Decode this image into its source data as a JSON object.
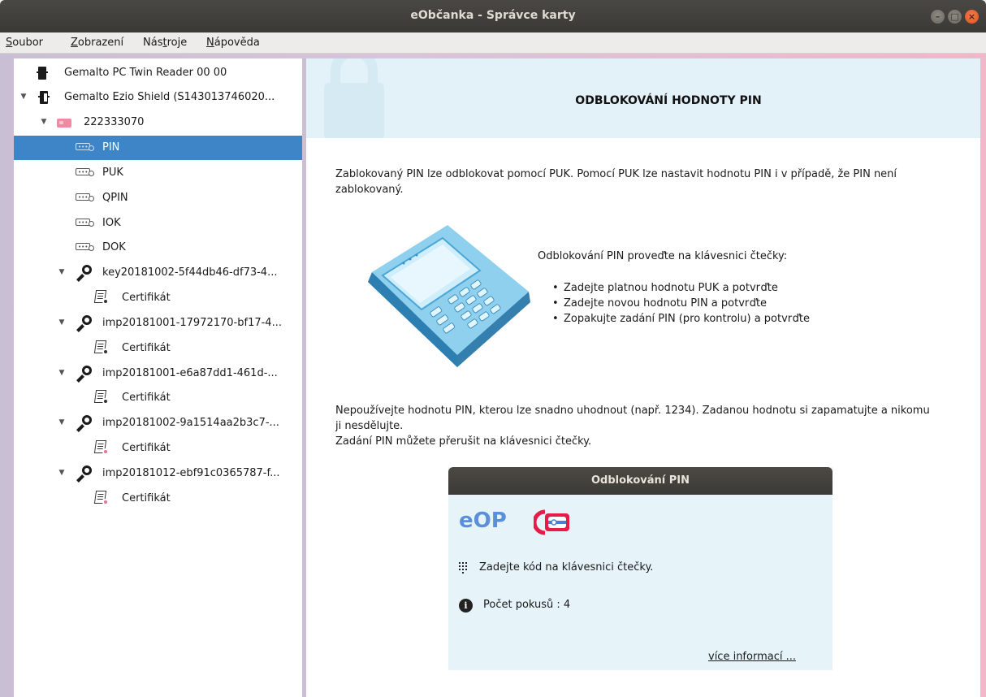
{
  "window": {
    "title": "eObčanka - Správce karty",
    "minimize_icon": "minimize-icon",
    "maximize_icon": "maximize-icon",
    "close_icon": "close-icon",
    "close_color": "#e95420"
  },
  "menu": [
    {
      "label": "Soubor",
      "mnemonic": "S",
      "rest": "oubor"
    },
    {
      "label": "Zobrazení",
      "mnemonic": "Z",
      "rest": "obrazení"
    },
    {
      "label": "Nástroje",
      "pre": "Nás",
      "mnemonic": "t",
      "rest": "roje"
    },
    {
      "label": "Nápověda",
      "mnemonic": "N",
      "rest": "ápověda"
    }
  ],
  "tree": {
    "selection_color": "#3d85c6",
    "items": [
      {
        "label": "Gemalto PC Twin Reader 00 00",
        "icon": "card-reader-icon",
        "expanded": null
      },
      {
        "label": "Gemalto Ezio Shield (S143013746020...",
        "icon": "card-reader-with-card-icon",
        "expanded": true
      },
      {
        "label": "222333070",
        "icon": "smart-card-icon",
        "expanded": true
      },
      {
        "label": "PIN",
        "icon": "pin-icon",
        "selected": true
      },
      {
        "label": "PUK",
        "icon": "pin-icon"
      },
      {
        "label": "QPIN",
        "icon": "pin-icon"
      },
      {
        "label": "IOK",
        "icon": "pin-icon"
      },
      {
        "label": "DOK",
        "icon": "pin-icon"
      },
      {
        "label": "key20181002-5f44db46-df73-4...",
        "icon": "key-pair-icon",
        "expanded": true
      },
      {
        "label": "Certifikát",
        "icon": "certificate-icon"
      },
      {
        "label": "imp20181001-17972170-bf17-4...",
        "icon": "key-pair-icon",
        "expanded": true
      },
      {
        "label": "Certifikát",
        "icon": "certificate-icon"
      },
      {
        "label": "imp20181001-e6a87dd1-461d-...",
        "icon": "key-pair-icon",
        "expanded": true
      },
      {
        "label": "Certifikát",
        "icon": "certificate-icon"
      },
      {
        "label": "imp20181002-9a1514aa2b3c7-...",
        "icon": "key-pair-icon",
        "expanded": true
      },
      {
        "label": "Certifikát",
        "icon": "certificate-pink-icon"
      },
      {
        "label": "imp20181012-ebf91c0365787-f...",
        "icon": "key-pair-icon",
        "expanded": true
      },
      {
        "label": "Certifikát",
        "icon": "certificate-pink-icon"
      }
    ]
  },
  "content": {
    "banner_title": "ODBLOKOVÁNÍ HODNOTY PIN",
    "banner_icon": "lock-icon",
    "intro_line1": "Zablokovaný PIN lze odblokovat pomocí PUK. Pomocí PUK lze nastavit hodnotu PIN i v případě, že PIN není",
    "intro_line2": "zablokovaný.",
    "reader_image": "card-terminal-illustration",
    "instructions_heading": "Odblokování PIN proveďte na klávesnici čtečky:",
    "instructions": [
      "Zadejte platnou hodnotu PUK a potvrďte",
      "Zadejte novou hodnotu PIN a potvrďte",
      "Zopakujte zadání PIN (pro kontrolu) a potvrďte"
    ],
    "warning_line1": "Nepoužívejte hodnotu PIN, kterou lze snadno uhodnout (např. 1234). Zadanou hodnotu si zapamatujte a nikomu",
    "warning_line2": "ji nesdělujte.",
    "warning_line3": "Zadání PIN můžete přerušit na klávesnici čtečky."
  },
  "dialog": {
    "title": "Odblokování PIN",
    "logo_text": "eOP",
    "logo_icon": "eop-card-logo",
    "prompt": "Zadejte kód na klávesnici čtečky.",
    "prompt_icon": "keypad-icon",
    "attempts_label": "Počet pokusů : 4",
    "attempts_icon": "info-icon",
    "more_link": "více informací ..."
  }
}
